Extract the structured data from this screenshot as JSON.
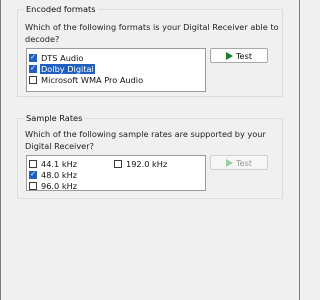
{
  "encoded_formats": {
    "title": "Encoded formats",
    "description": "Which of the following formats is your Digital Receiver able to decode?",
    "items": [
      {
        "label": "DTS Audio",
        "checked": true,
        "selected": false
      },
      {
        "label": "Dolby Digital",
        "checked": true,
        "selected": true
      },
      {
        "label": "Microsoft WMA Pro Audio",
        "checked": false,
        "selected": false
      }
    ],
    "test_button": "Test"
  },
  "sample_rates": {
    "title": "Sample Rates",
    "description": "Which of the following sample rates are supported by your Digital Receiver?",
    "items": [
      {
        "label": "44.1 kHz",
        "checked": false
      },
      {
        "label": "48.0 kHz",
        "checked": true
      },
      {
        "label": "96.0 kHz",
        "checked": false
      },
      {
        "label": "192.0 kHz",
        "checked": false
      }
    ],
    "test_button": "Test"
  },
  "colors": {
    "accent": "#1f5fbf",
    "play_icon": "#1a7d2c"
  },
  "icons": {
    "play": "play-icon",
    "check": "checkmark-icon"
  }
}
